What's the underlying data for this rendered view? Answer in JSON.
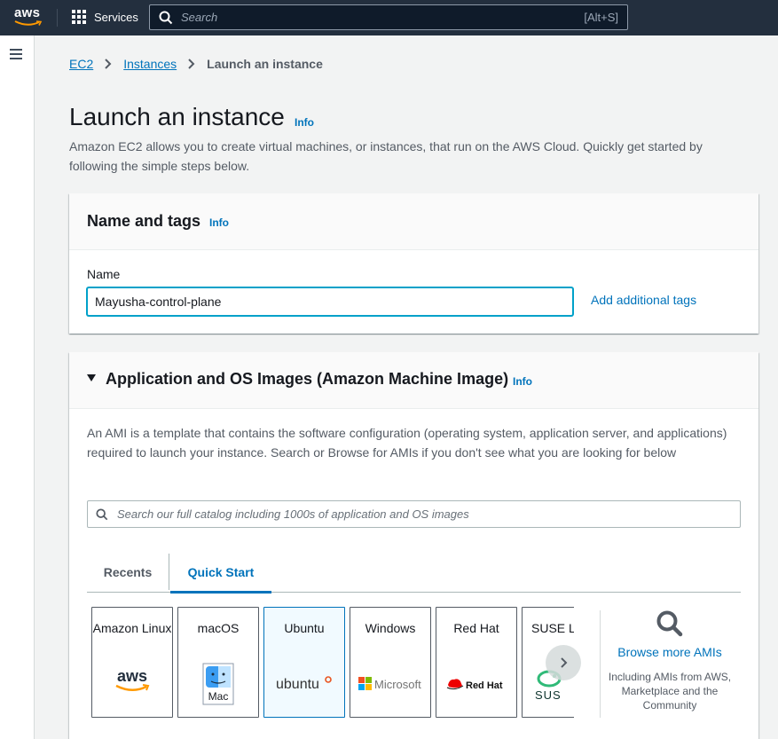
{
  "topnav": {
    "logo_text": "aws",
    "services_label": "Services",
    "search_placeholder": "Search",
    "search_shortcut": "[Alt+S]"
  },
  "breadcrumb": {
    "items": [
      "EC2",
      "Instances"
    ],
    "current": "Launch an instance"
  },
  "page": {
    "title": "Launch an instance",
    "info": "Info",
    "description": "Amazon EC2 allows you to create virtual machines, or instances, that run on the AWS Cloud. Quickly get started by following the simple steps below."
  },
  "name_tags": {
    "title": "Name and tags",
    "info": "Info",
    "name_label": "Name",
    "name_value": "Mayusha-control-plane",
    "add_tags": "Add additional tags"
  },
  "ami": {
    "title": "Application and OS Images (Amazon Machine Image)",
    "info": "Info",
    "description": "An AMI is a template that contains the software configuration (operating system, application server, and applications) required to launch your instance. Search or Browse for AMIs if you don't see what you are looking for below",
    "search_placeholder": "Search our full catalog including 1000s of application and OS images",
    "tabs": [
      "Recents",
      "Quick Start"
    ],
    "active_tab": "Quick Start",
    "cards": [
      {
        "name": "Amazon Linux",
        "logo": "aws-logo",
        "logo_text": "aws"
      },
      {
        "name": "macOS",
        "logo": "finder-icon",
        "logo_text": "Mac"
      },
      {
        "name": "Ubuntu",
        "logo": "ubuntu-logo",
        "logo_text": "ubuntu",
        "selected": true
      },
      {
        "name": "Windows",
        "logo": "microsoft-logo",
        "logo_text": "Microsoft"
      },
      {
        "name": "Red Hat",
        "logo": "redhat-logo",
        "logo_text": "Red Hat"
      },
      {
        "name": "SUSE Li",
        "logo": "suse-logo",
        "logo_text": "SUS"
      }
    ],
    "browse_link": "Browse more AMIs",
    "browse_sub": "Including AMIs from AWS, Marketplace and the Community"
  },
  "colors": {
    "nav_bg": "#232f3e",
    "link": "#0073bb",
    "aws_orange": "#ff9900",
    "ubuntu_orange": "#e95420",
    "redhat_red": "#ee0000",
    "suse_green": "#30ba78"
  }
}
